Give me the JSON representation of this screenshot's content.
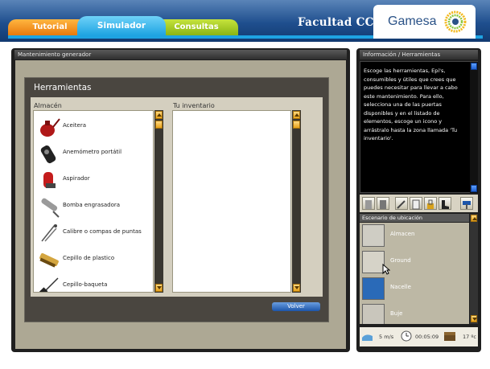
{
  "tabs": [
    {
      "label": "Tutorial"
    },
    {
      "label": "Simulador"
    },
    {
      "label": "Consultas"
    }
  ],
  "brand": {
    "title": "Facultad CCS",
    "logo_text": "Gamesa"
  },
  "main": {
    "header": "Mantenimiento generador",
    "dialog": {
      "title": "Herramientas",
      "left_label": "Almacén",
      "right_label": "Tu inventario",
      "tools": [
        {
          "name": "Aceitera",
          "icon": "oil-can-icon"
        },
        {
          "name": "Anemómetro portátil",
          "icon": "anemometer-icon"
        },
        {
          "name": "Aspirador",
          "icon": "vacuum-icon"
        },
        {
          "name": "Bomba engrasadora",
          "icon": "grease-pump-icon"
        },
        {
          "name": "Calibre o compas de puntas",
          "icon": "caliper-icon"
        },
        {
          "name": "Cepillo de plastico",
          "icon": "plastic-brush-icon"
        },
        {
          "name": "Cepillo-baqueta",
          "icon": "rod-brush-icon"
        }
      ],
      "inventory": [],
      "volver_label": "Volver"
    }
  },
  "right": {
    "header": "Información / Herramientas",
    "info_text": "Escoge las herramientas, Epi's, consumibles y útiles que crees que puedes necesitar para llevar a cabo este mantenimiento. Para ello, selecciona una de las puertas disponibles y en el listado de elementos, escoge un icono y arrástralo hasta la zona llamada 'Tu inventario'.",
    "scenario_header": "Escenario de ubicación",
    "scenarios": [
      {
        "label": "Almacen"
      },
      {
        "label": "Ground"
      },
      {
        "label": "Nacelle"
      },
      {
        "label": "Buje"
      }
    ],
    "status": {
      "wind": "5 m/s",
      "time": "00:05:09",
      "temp": "17 ºc"
    }
  },
  "colors": {
    "topbar": "#1f4f8e",
    "tab_tutorial": "#e8790c",
    "tab_simulador": "#1ea3e2",
    "tab_consultas": "#8ab414",
    "accent_scroll": "#e7a21a"
  }
}
